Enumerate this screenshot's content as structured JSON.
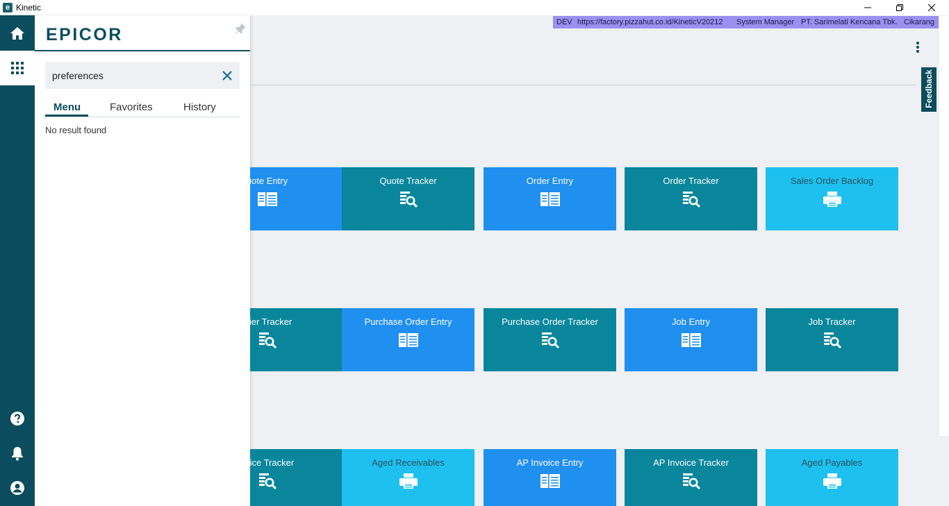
{
  "window": {
    "title": "Kinetic"
  },
  "panel": {
    "brand": "EPICOR",
    "search_value": "preferences",
    "tabs": [
      {
        "label": "Menu"
      },
      {
        "label": "Favorites"
      },
      {
        "label": "History"
      }
    ],
    "empty_message": "No result found"
  },
  "env": {
    "env": "DEV",
    "url": "https://factory.pizzahut.co.id/KineticV20212",
    "role": "System Manager",
    "company": "PT. Sarimelati Kencana Tbk.",
    "site": "Cikarang"
  },
  "feedback_label": "Feedback",
  "colors": {
    "rail": "#0b4d5e",
    "tile_blue": "#1f8ff0",
    "tile_teal": "#09869c",
    "tile_light": "#1ec0ef",
    "env_bar": "#9b8ff0"
  },
  "tiles": [
    {
      "label": "Quote Entry",
      "visible_label": "uote Entry",
      "icon": "entry-icon",
      "color": "blue"
    },
    {
      "label": "Quote Tracker",
      "icon": "tracker-icon",
      "color": "teal"
    },
    {
      "label": "Order Entry",
      "icon": "entry-icon",
      "color": "blue"
    },
    {
      "label": "Order Tracker",
      "icon": "tracker-icon",
      "color": "teal"
    },
    {
      "label": "Sales Order Backlog",
      "icon": "printer-icon",
      "color": "light"
    },
    {
      "label": "Supplier Tracker",
      "visible_label": "plier Tracker",
      "icon": "tracker-icon",
      "color": "teal"
    },
    {
      "label": "Purchase Order Entry",
      "icon": "entry-icon",
      "color": "blue"
    },
    {
      "label": "Purchase Order Tracker",
      "icon": "tracker-icon",
      "color": "teal"
    },
    {
      "label": "Job Entry",
      "icon": "entry-icon",
      "color": "blue"
    },
    {
      "label": "Job Tracker",
      "icon": "tracker-icon",
      "color": "teal"
    },
    {
      "label": "AR Invoice Tracker",
      "visible_label": "voice Tracker",
      "icon": "tracker-icon",
      "color": "teal"
    },
    {
      "label": "Aged Receivables",
      "icon": "printer-icon",
      "color": "light"
    },
    {
      "label": "AP Invoice Entry",
      "icon": "entry-icon",
      "color": "blue"
    },
    {
      "label": "AP Invoice Tracker",
      "icon": "tracker-icon",
      "color": "teal"
    },
    {
      "label": "Aged Payables",
      "icon": "printer-icon",
      "color": "light"
    }
  ]
}
